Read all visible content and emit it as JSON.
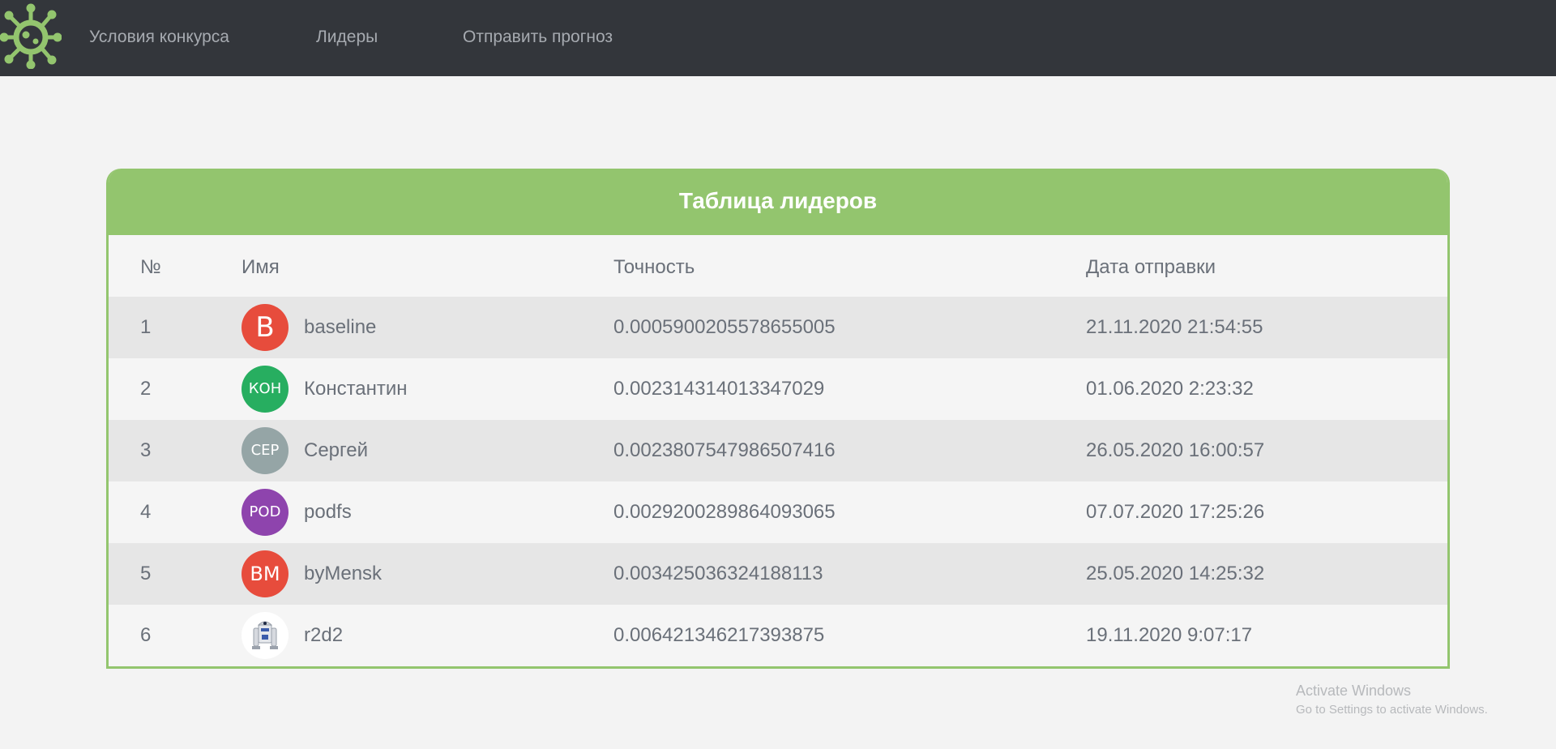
{
  "nav": {
    "items": [
      {
        "label": "Условия конкурса"
      },
      {
        "label": "Лидеры"
      },
      {
        "label": "Отправить прогноз"
      }
    ]
  },
  "leaderboard": {
    "title": "Таблица лидеров",
    "columns": [
      "№",
      "Имя",
      "Точность",
      "Дата отправки"
    ],
    "rows": [
      {
        "rank": "1",
        "avatar_text": "B",
        "avatar_color": "#e74c3c",
        "name": "baseline",
        "accuracy": "0.0005900205578655005",
        "date": "21.11.2020 21:54:55"
      },
      {
        "rank": "2",
        "avatar_text": "КОН",
        "avatar_color": "#27ae60",
        "name": "Константин",
        "accuracy": "0.002314314013347029",
        "date": "01.06.2020 2:23:32"
      },
      {
        "rank": "3",
        "avatar_text": "СЕР",
        "avatar_color": "#95a5a6",
        "name": "Сергей",
        "accuracy": "0.0023807547986507416",
        "date": "26.05.2020 16:00:57"
      },
      {
        "rank": "4",
        "avatar_text": "POD",
        "avatar_color": "#8e44ad",
        "name": "podfs",
        "accuracy": "0.0029200289864093065",
        "date": "07.07.2020 17:25:26"
      },
      {
        "rank": "5",
        "avatar_text": "BM",
        "avatar_color": "#e74c3c",
        "name": "byMensk",
        "accuracy": "0.003425036324188113",
        "date": "25.05.2020 14:25:32"
      },
      {
        "rank": "6",
        "avatar_text": "",
        "avatar_color": "#ffffff",
        "avatar_icon": "robot-avatar-icon",
        "name": "r2d2",
        "accuracy": "0.006421346217393875",
        "date": "19.11.2020 9:07:17"
      }
    ]
  },
  "watermark": {
    "line1": "Activate Windows",
    "line2": "Go to Settings to activate Windows."
  },
  "colors": {
    "topbar": "#33363b",
    "accent": "#93c56e"
  }
}
